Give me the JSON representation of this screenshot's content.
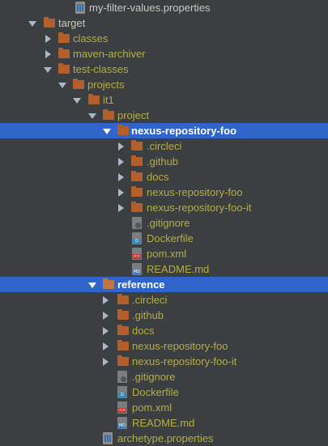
{
  "tree": {
    "rows": [
      {
        "label": "my-filter-values.properties",
        "icon": "properties-file-icon",
        "color": "olive"
      },
      {
        "label": "target",
        "icon": "folder-icon",
        "expanded": true
      },
      {
        "label": "classes",
        "icon": "folder-icon",
        "expanded": false
      },
      {
        "label": "maven-archiver",
        "icon": "folder-icon",
        "expanded": false
      },
      {
        "label": "test-classes",
        "icon": "folder-icon",
        "expanded": true
      },
      {
        "label": "projects",
        "icon": "folder-icon",
        "expanded": true
      },
      {
        "label": "it1",
        "icon": "folder-icon",
        "expanded": true
      },
      {
        "label": "project",
        "icon": "folder-icon",
        "expanded": true
      },
      {
        "label": "nexus-repository-foo",
        "icon": "folder-icon",
        "expanded": true,
        "selected": true
      },
      {
        "label": ".circleci",
        "icon": "folder-icon",
        "expanded": false
      },
      {
        "label": ".github",
        "icon": "folder-icon",
        "expanded": false
      },
      {
        "label": "docs",
        "icon": "folder-icon",
        "expanded": false
      },
      {
        "label": "nexus-repository-foo",
        "icon": "folder-icon",
        "expanded": false
      },
      {
        "label": "nexus-repository-foo-it",
        "icon": "folder-icon",
        "expanded": false
      },
      {
        "label": ".gitignore",
        "icon": "gitignore-file-icon"
      },
      {
        "label": "Dockerfile",
        "icon": "dockerfile-icon"
      },
      {
        "label": "pom.xml",
        "icon": "xml-file-icon"
      },
      {
        "label": "README.md",
        "icon": "markdown-file-icon"
      },
      {
        "label": "reference",
        "icon": "folder-icon",
        "expanded": true,
        "selected": true
      },
      {
        "label": ".circleci",
        "icon": "folder-icon",
        "expanded": false
      },
      {
        "label": ".github",
        "icon": "folder-icon",
        "expanded": false
      },
      {
        "label": "docs",
        "icon": "folder-icon",
        "expanded": false
      },
      {
        "label": "nexus-repository-foo",
        "icon": "folder-icon",
        "expanded": false
      },
      {
        "label": "nexus-repository-foo-it",
        "icon": "folder-icon",
        "expanded": false
      },
      {
        "label": ".gitignore",
        "icon": "gitignore-file-icon"
      },
      {
        "label": "Dockerfile",
        "icon": "dockerfile-icon"
      },
      {
        "label": "pom.xml",
        "icon": "xml-file-icon"
      },
      {
        "label": "README.md",
        "icon": "markdown-file-icon"
      },
      {
        "label": "archetype.properties",
        "icon": "properties-file-icon"
      }
    ],
    "icon_tags": {
      "docker": "D",
      "xml": "<>",
      "md": "MD"
    }
  }
}
